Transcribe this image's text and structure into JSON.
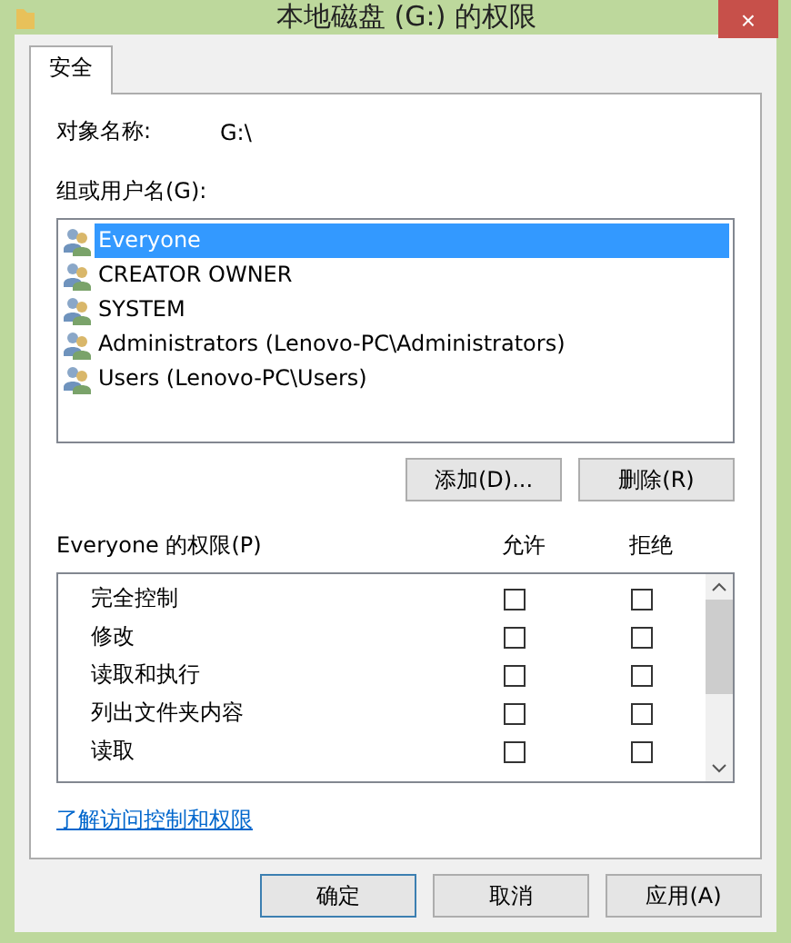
{
  "window": {
    "title": "本地磁盘 (G:) 的权限",
    "close": "×"
  },
  "tabs": [
    {
      "label": "安全",
      "selected": true
    }
  ],
  "object": {
    "label": "对象名称:",
    "value": "G:\\"
  },
  "groups": {
    "label": "组或用户名(G):",
    "items": [
      {
        "name": "Everyone",
        "selected": true
      },
      {
        "name": "CREATOR OWNER",
        "selected": false
      },
      {
        "name": "SYSTEM",
        "selected": false
      },
      {
        "name": "Administrators (Lenovo-PC\\Administrators)",
        "selected": false
      },
      {
        "name": "Users (Lenovo-PC\\Users)",
        "selected": false
      }
    ]
  },
  "group_buttons": [
    "添加(D)...",
    "删除(R)"
  ],
  "permissions": {
    "label": "Everyone 的权限(P)",
    "allow_header": "允许",
    "deny_header": "拒绝",
    "rows": [
      {
        "name": "完全控制",
        "allow": false,
        "deny": false
      },
      {
        "name": "修改",
        "allow": false,
        "deny": false
      },
      {
        "name": "读取和执行",
        "allow": false,
        "deny": false
      },
      {
        "name": "列出文件夹内容",
        "allow": false,
        "deny": false
      },
      {
        "name": "读取",
        "allow": false,
        "deny": false
      }
    ]
  },
  "link": "了解访问控制和权限",
  "buttons": [
    {
      "label": "确定",
      "default": true
    },
    {
      "label": "取消",
      "default": false
    },
    {
      "label": "应用(A)",
      "default": false
    }
  ]
}
